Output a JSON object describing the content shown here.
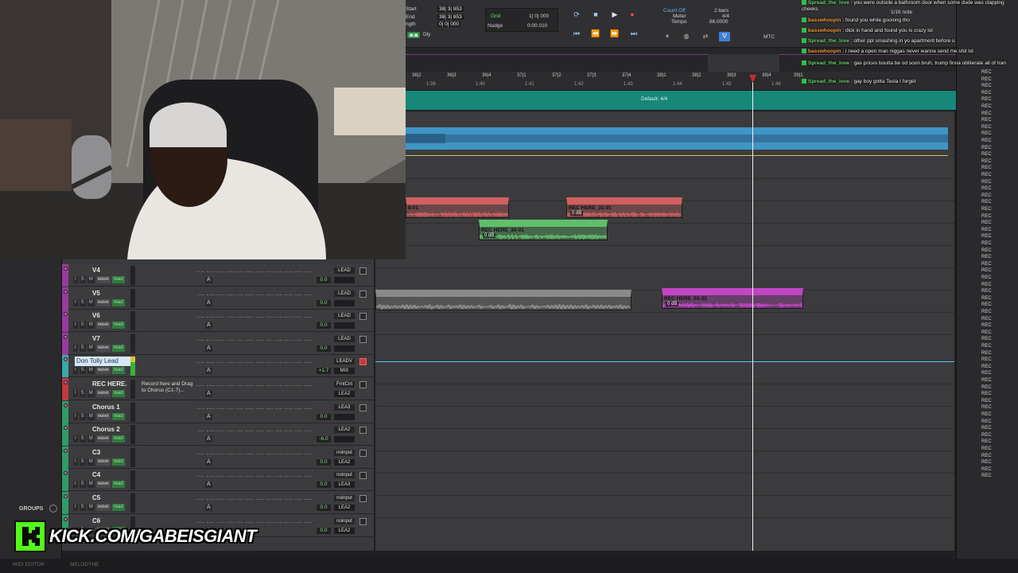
{
  "transport": {
    "start_label": "Start",
    "end_label": "End",
    "length_label": "ngth",
    "start_val": "38| 3| 853",
    "end_val": "38| 3| 853",
    "length_val": "0| 0| 000",
    "dly_label": "Dly",
    "grid_label": "Grid",
    "grid_val": "1| 0| 000",
    "nudge_label": "Nudge",
    "nudge_val": "0:00.010",
    "count_off": "Count Off",
    "meter_label": "Meter",
    "tempo_label": "Tempo",
    "bars": "2 bars",
    "meter_val": "4/4",
    "tempo_val": "86.0000",
    "note_val": "1/16 note",
    "mtc": "MTC"
  },
  "ruler": {
    "bars": [
      "36|2",
      "36|3",
      "36|4",
      "37|1",
      "37|2",
      "37|3",
      "37|4",
      "38|1",
      "38|2",
      "38|3",
      "38|4",
      "39|1"
    ],
    "times": [
      "1:39",
      "1:40",
      "1:41",
      "1:42",
      "1:43",
      "1:44",
      "1:45",
      "1:46"
    ]
  },
  "meter_bar": {
    "label": "Default: 4/4"
  },
  "chat": [
    {
      "user": "Spread_the_love",
      "text": "you were outside a bathroom door when some dude was clapping cheeks",
      "color": "#6cd36c"
    },
    {
      "user": "basswhoopin",
      "text": "found you while gooning tho",
      "color": "#f29a3b"
    },
    {
      "user": "basswhoopin",
      "text": "dick in hand and found you is crazy lol",
      "color": "#f29a3b"
    },
    {
      "user": "Spread_the_love",
      "text": "other ppl smashing in yo apartment before u",
      "color": "#6cd36c"
    },
    {
      "user": "basswhoopin",
      "text": "i need a open man niggas never wanna send me shit lol",
      "color": "#f29a3b"
    },
    {
      "user": "Spread_the_love",
      "text": "gas prices boutta be od soon bruh, trump finna obliterate all of Iran",
      "color": "#6cd36c"
    },
    {
      "user": "Spread_the_love",
      "text": "gay boy gotta Tesla I forget",
      "color": "#6cd36c"
    }
  ],
  "tracks": [
    {
      "name": "V4",
      "color": "#9a3aa0",
      "vol": "0.0",
      "bus": "LEAD",
      "inserts": "",
      "meter": false
    },
    {
      "name": "V5",
      "color": "#9a3aa0",
      "vol": "0.0",
      "bus": "LEAD",
      "inserts": "",
      "meter": false
    },
    {
      "name": "V6",
      "color": "#9a3aa0",
      "vol": "0.0",
      "bus": "LEAD",
      "inserts": "",
      "meter": false
    },
    {
      "name": "V7",
      "color": "#9a3aa0",
      "vol": "0.0",
      "bus": "LEAD",
      "inserts": "",
      "meter": false
    },
    {
      "name": "Don Tolly Lead",
      "color": "#3aa8a8",
      "vol": "+1.7",
      "bus": "LEADV",
      "bus2": "MIX",
      "inserts": "",
      "meter": true,
      "selected": true
    },
    {
      "name": "REC HERE.",
      "color": "#c23a3a",
      "vol": "",
      "bus": "FrntCnt",
      "bus2": "LEA2",
      "note": "Record here and Drag to Chorus (C1-7)...",
      "meter": false
    },
    {
      "name": "Chorus 1",
      "color": "#2d9c6a",
      "vol": "0.0",
      "bus": "LEA3",
      "meter": false
    },
    {
      "name": "Chorus 2",
      "color": "#2d9c6a",
      "vol": "-6.0",
      "bus": "LEA2",
      "meter": false
    },
    {
      "name": "C3",
      "color": "#2d9c6a",
      "vol": "0.0",
      "bus": "noinput",
      "bus2": "LEA2",
      "meter": false
    },
    {
      "name": "C4",
      "color": "#2d9c6a",
      "vol": "0.0",
      "bus": "noinput",
      "bus2": "LEA3",
      "meter": false
    },
    {
      "name": "C5",
      "color": "#2d9c6a",
      "vol": "0.0",
      "bus": "noinput",
      "bus2": "LEA2",
      "meter": false
    },
    {
      "name": "C6",
      "color": "#2d9c6a",
      "vol": "0.0",
      "bus": "noinput",
      "bus2": "LEA2",
      "meter": false
    }
  ],
  "track_buttons": {
    "i": "I",
    "s": "S",
    "m": "M",
    "wave": "wave",
    "read": "read"
  },
  "clips": [
    {
      "name": "8-01",
      "gain": "",
      "color": "#d0605f"
    },
    {
      "name": "REC HERE_31-01",
      "gain": "0 dB",
      "color": "#d0605f"
    },
    {
      "name": "REC HERE_30-01",
      "gain": "0 dB",
      "color": "#5fbf6a"
    },
    {
      "name": "",
      "gain": "",
      "color": "#8a8a8a"
    },
    {
      "name": "REC HERE_03-22",
      "gain": "0 dB",
      "color": "#c046c4"
    }
  ],
  "sidebar": {
    "groups_label": "GROUPS"
  },
  "bottom": {
    "midi_editor": "MIDI EDITOR",
    "melodyne": "MELODYNE"
  },
  "overlay": {
    "kick_text": "KICK.COM/GABEISGIANT"
  },
  "rec_list_label": "REC"
}
